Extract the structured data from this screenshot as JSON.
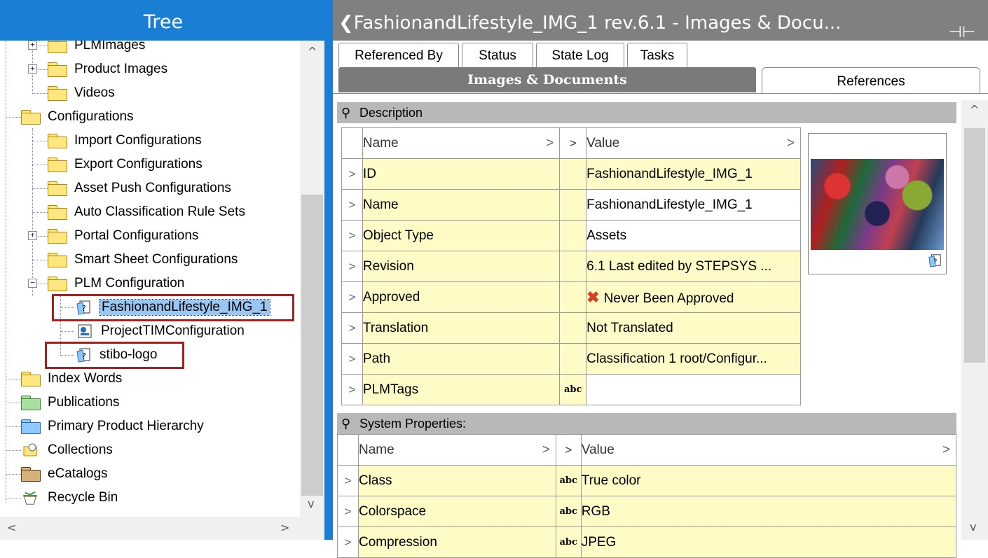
{
  "tree": {
    "title": "Tree",
    "items": [
      {
        "label": "PLMImages",
        "expander": "+"
      },
      {
        "label": "Product Images",
        "expander": "+"
      },
      {
        "label": "Videos",
        "expander": ""
      },
      {
        "label": "Configurations",
        "expander": ""
      },
      {
        "label": "Import Configurations",
        "expander": ""
      },
      {
        "label": "Export Configurations",
        "expander": ""
      },
      {
        "label": "Asset Push Configurations",
        "expander": ""
      },
      {
        "label": "Auto Classification Rule Sets",
        "expander": ""
      },
      {
        "label": "Portal Configurations",
        "expander": "+"
      },
      {
        "label": "Smart Sheet Configurations",
        "expander": ""
      },
      {
        "label": "PLM Configuration",
        "expander": "−"
      },
      {
        "label": "FashionandLifestyle_IMG_1",
        "expander": ""
      },
      {
        "label": "ProjectTIMConfiguration",
        "expander": ""
      },
      {
        "label": "stibo-logo",
        "expander": ""
      },
      {
        "label": "Index Words",
        "expander": ""
      },
      {
        "label": "Publications",
        "expander": ""
      },
      {
        "label": "Primary Product Hierarchy",
        "expander": ""
      },
      {
        "label": "Collections",
        "expander": ""
      },
      {
        "label": "eCatalogs",
        "expander": ""
      },
      {
        "label": "Recycle Bin",
        "expander": ""
      }
    ],
    "scroll_up": "^",
    "scroll_down": "v",
    "scroll_left": "<",
    "scroll_right": ">"
  },
  "editor": {
    "title": "FashionandLifestyle_IMG_1 rev.6.1 - Images & Docu...",
    "back_glyph": "❮",
    "pin_glyph": "⊣⊢",
    "tabs": [
      {
        "label": "Referenced By"
      },
      {
        "label": "Status"
      },
      {
        "label": "State Log"
      },
      {
        "label": "Tasks"
      }
    ],
    "main_tab": "Images & Documents",
    "references_tab": "References",
    "scroll_up": "^",
    "scroll_down": "v"
  },
  "description": {
    "title": "Description",
    "col_name": "Name",
    "col_value": "Value",
    "rows": [
      {
        "name": "ID",
        "value": "FashionandLifestyle_IMG_1",
        "flag": ""
      },
      {
        "name": "Name",
        "value": "FashionandLifestyle_IMG_1",
        "flag": ""
      },
      {
        "name": "Object Type",
        "value": "Assets",
        "flag": ""
      },
      {
        "name": "Revision",
        "value": "6.1 Last edited by STEPSYS ...",
        "flag": ""
      },
      {
        "name": "Approved",
        "value": "Never Been Approved",
        "flag": ""
      },
      {
        "name": "Translation",
        "value": "Not Translated",
        "flag": ""
      },
      {
        "name": "Path",
        "value": "Classification 1 root/Configur...",
        "flag": ""
      },
      {
        "name": "PLMTags",
        "value": "",
        "flag": "abc"
      }
    ]
  },
  "system_properties": {
    "title": "System Properties:",
    "col_name": "Name",
    "col_value": "Value",
    "rows": [
      {
        "name": "Class",
        "value": "True color",
        "flag": "abc"
      },
      {
        "name": "Colorspace",
        "value": "RGB",
        "flag": "abc"
      },
      {
        "name": "Compression",
        "value": "JPEG",
        "flag": "abc"
      }
    ]
  },
  "colors": {
    "tree_header": "#1a7fd4",
    "editor_header": "#808080",
    "selection_box": "#a3201f",
    "property_cell": "#fffbc6"
  }
}
